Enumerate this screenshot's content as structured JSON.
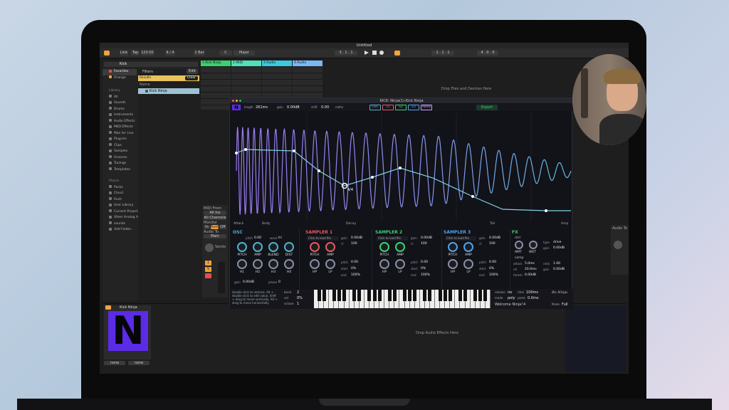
{
  "window": {
    "title": "Untitled",
    "tempo": "120.00",
    "tap": "Tap",
    "sig": "4 / 4",
    "bar": "1 Bar",
    "key": "C",
    "scale": "Major",
    "link": "Link",
    "pos": "3 . 1 . 1",
    "pos2": "1 . 1 . 1",
    "pos3": "4 . 0 . 0"
  },
  "browser": {
    "search": "Kick",
    "favorites": "Favorites",
    "orange": "Orange",
    "filters": "Filters",
    "edit": "Edit",
    "results": "Results",
    "clear": "Clear",
    "name_header": "Name",
    "result_item": "Kick Ninja",
    "library": "Library",
    "library_items": [
      "All",
      "Sounds",
      "Drums",
      "Instruments",
      "Audio Effects",
      "MIDI Effects",
      "Max for Live",
      "Plug-Ins",
      "Clips",
      "Samples",
      "Grooves",
      "Tunings",
      "Templates"
    ],
    "places": "Places",
    "places_items": [
      "Packs",
      "Cloud",
      "Push",
      "User Library",
      "Current Project",
      "Xfees Analog Ar",
      "sounds",
      "Add Folder..."
    ]
  },
  "tracks": [
    {
      "name": "1 Kick Ninja",
      "color": "#3bd16f"
    },
    {
      "name": "2 MIDI",
      "color": "#4fe2b8"
    },
    {
      "name": "3 Audio",
      "color": "#3cc8e0"
    },
    {
      "name": "4 Audio",
      "color": "#7ab8f5"
    }
  ],
  "session": {
    "drop_text": "Drop Files and Devices Here",
    "drop_audio": "Drop Audio Effects Here",
    "io_midi_from": "MIDI From",
    "io_all_ins": "All Ins",
    "io_all_channels": "All Channels",
    "io_monitor": "Monitor",
    "io_in": "In",
    "io_auto": "Auto",
    "io_off": "Off",
    "io_audio_to": "Audio To",
    "io_main": "Main",
    "sends": "Sends",
    "track_num": "1",
    "solo": "S"
  },
  "device": {
    "title": "Kick Ninja",
    "logo": "N"
  },
  "bottom": {
    "sel1": "none",
    "sel2": "none"
  },
  "plugin": {
    "title": "KICK: Ninja(1)-Kick Ninja",
    "length_label": "length",
    "length": "261ms",
    "gain_label": "gain",
    "gain": "0.00dB",
    "shift_label": "shift",
    "shift": "0.00",
    "mdhz_label": "mdhz",
    "tabs": [
      "OSC",
      "S1",
      "S2",
      "S3",
      "MAIN"
    ],
    "export": "Export",
    "labels": [
      "Attack",
      "Body",
      "Decay",
      "Tail",
      "Amp"
    ],
    "point_value": "4/4",
    "sections": [
      {
        "name": "OSC",
        "color": "#4fb3c8",
        "pitch_label": "pitch",
        "pitch": "0.00",
        "wave_label": "wave",
        "wave": "tri",
        "knobs": [
          "PITCH",
          "AMP",
          "BLEND",
          "DIST"
        ],
        "knobs2": [
          "H1",
          "H2",
          "H3",
          "H4"
        ],
        "gain_label": "gain",
        "gain": "0.00dB",
        "phase_label": "phase",
        "phase": "0"
      },
      {
        "name": "SAMPLER 1",
        "color": "#e85a5a",
        "load": "Click to load file",
        "gain_label": "gain",
        "gain": "0.00dB",
        "rt_label": "rt",
        "rt": "100",
        "knobs": [
          "PITCH",
          "AMP"
        ],
        "knobs2": [
          "HP",
          "LP"
        ],
        "pitch_label": "pitch",
        "pitch": "0.00",
        "start_label": "start",
        "start": "0%",
        "end_label": "end",
        "end": "100%"
      },
      {
        "name": "SAMPLER 2",
        "color": "#3bd16f",
        "load": "Click to load file",
        "gain_label": "gain",
        "gain": "0.00dB",
        "rt_label": "rt",
        "rt": "100",
        "knobs": [
          "PITCH",
          "AMP"
        ],
        "knobs2": [
          "HP",
          "LP"
        ],
        "pitch_label": "pitch",
        "pitch": "0.00",
        "start_label": "start",
        "start": "0%",
        "end_label": "end",
        "end": "100%"
      },
      {
        "name": "SAMPLER 3",
        "color": "#4fa3e8",
        "load": "Click to load file",
        "gain_label": "gain",
        "gain": "0.00dB",
        "rt_label": "rt",
        "rt": "100",
        "knobs": [
          "PITCH",
          "AMP"
        ],
        "knobs2": [
          "HP",
          "LP"
        ],
        "pitch_label": "pitch",
        "pitch": "0.00",
        "start_label": "start",
        "start": "0%",
        "end_label": "end",
        "end": "100%"
      }
    ],
    "fx": {
      "name": "FX",
      "dist": "dist",
      "type_label": "type",
      "type": "drive",
      "gain_label": "gain",
      "gain": "0.00dB",
      "amt": "AMT",
      "wet": "WET",
      "comp": "comp",
      "attack_label": "attack",
      "attack": "5.0ms",
      "ratio_label": "ratio",
      "ratio": "1.00",
      "rel_label": "rel",
      "rel": "20.0ms",
      "gain2_label": "gain",
      "gain2": "0.00dB",
      "thresh_label": "thresh",
      "thresh": "0.00dB"
    },
    "help": "double click to remove, Alt + double click to edit value, Shift + drag to move vertically, Alt + drag to move horizontally",
    "bend_label": "bend",
    "bend": "2",
    "vel_label": "vel",
    "vel": "0%",
    "octave_label": "octave",
    "octave": "1",
    "release_label": "release",
    "release": "no",
    "time_label": "time",
    "time": "100ms",
    "mode_label": "mode",
    "mode": "poly",
    "porta_label": "porta",
    "porta": "0.0ms",
    "welcome": "Welcome Ninja!",
    "welcome_num": "4",
    "mode2_label": "Mode",
    "mode2": "Full",
    "signature": "Bo Ninja"
  }
}
